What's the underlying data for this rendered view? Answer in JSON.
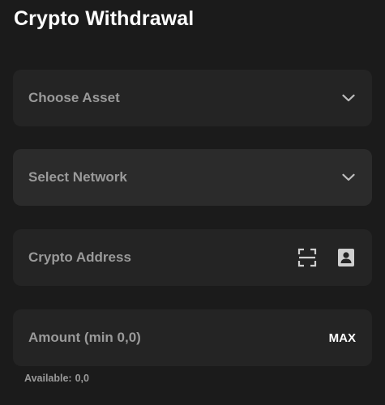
{
  "page": {
    "title": "Crypto Withdrawal"
  },
  "asset_select": {
    "label": "Choose Asset",
    "icon": "chevron-down-icon"
  },
  "network_select": {
    "label": "Select Network",
    "icon": "chevron-down-icon"
  },
  "address_input": {
    "placeholder": "Crypto Address",
    "value": "",
    "icons": [
      "qr-scan-icon",
      "address-book-icon"
    ]
  },
  "amount_input": {
    "placeholder": "Amount (min 0,0)",
    "value": "",
    "max_label": "MAX"
  },
  "available": {
    "label": "Available:",
    "value": "0,0"
  },
  "colors": {
    "background": "#1b1b1b",
    "field_background": "#242424",
    "field_hover_background": "#2b2b2b",
    "muted_text": "#9a9a9a",
    "primary_text": "#ffffff"
  }
}
